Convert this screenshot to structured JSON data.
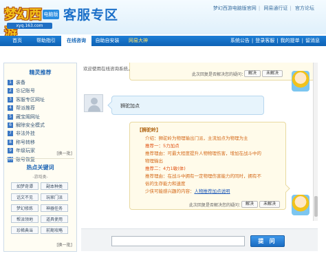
{
  "header": {
    "brand": "梦幻西游",
    "brand_tag": "电脑版",
    "brand_url": "xyq.163.com",
    "title": "客服专区",
    "top_links": [
      "梦幻西游电脑版官网",
      "网易通行证",
      "官方论坛"
    ]
  },
  "nav": {
    "items": [
      "首页",
      "帮助指引",
      "在线咨询",
      "自助自安装",
      "网易大神"
    ],
    "active_index": 2,
    "right_links": [
      "系统公告",
      "登录客服",
      "我的提单",
      "留消息"
    ]
  },
  "sidebar": {
    "recommend_title": "精灵推荐",
    "recommend_items": [
      {
        "num": "1",
        "label": "装备"
      },
      {
        "num": "2",
        "label": "忘记账号"
      },
      {
        "num": "3",
        "label": "客服专区网址"
      },
      {
        "num": "4",
        "label": "帮派推荐"
      },
      {
        "num": "5",
        "label": "藏宝阁网址"
      },
      {
        "num": "6",
        "label": "解除安全模式"
      },
      {
        "num": "7",
        "label": "非法外挂"
      },
      {
        "num": "8",
        "label": "称号转移"
      },
      {
        "num": "9",
        "label": "年级玩家"
      },
      {
        "num": "10",
        "label": "账号恢复"
      }
    ],
    "swap_label": "[换一批]",
    "hot_title": "热点关键词",
    "hot_subtitle": "-游戏类-",
    "keywords": [
      "如梦奇谭",
      "副本种类",
      "话文不见",
      "玩家门派",
      "梦幻修炼",
      "神器任务",
      "帮派领地",
      "道具使用",
      "珍稀典当",
      "前期攻略"
    ]
  },
  "chat": {
    "welcome": "欢迎使用在线咨询系统，请您在下方输入提问内容。",
    "feedback_text": "此次回复是否解决您的疑问：",
    "resolved_label": "解决",
    "unresolved_label": "未解决",
    "user_message": "狮驼加点",
    "answer_title": "【狮驼岭】",
    "answer_lines": [
      "介绍：狮驼岭为物理输出门派，主流加点为物理为主",
      "推荐一：5力加点",
      "推荐理由：可最大程度提升人物物理伤害，增加在战斗中的",
      "物理输出",
      "推荐二：4力1敏(体)",
      "推荐理由：在战斗中拥有一定物理伤害能力的同时，拥有不",
      "俗的生存能力和速度"
    ],
    "answer_more_prefix": "少侠可能感兴趣的内容：",
    "answer_more_link": "人物推荐加点说明"
  },
  "input": {
    "placeholder": "",
    "button_label": "提 问"
  }
}
